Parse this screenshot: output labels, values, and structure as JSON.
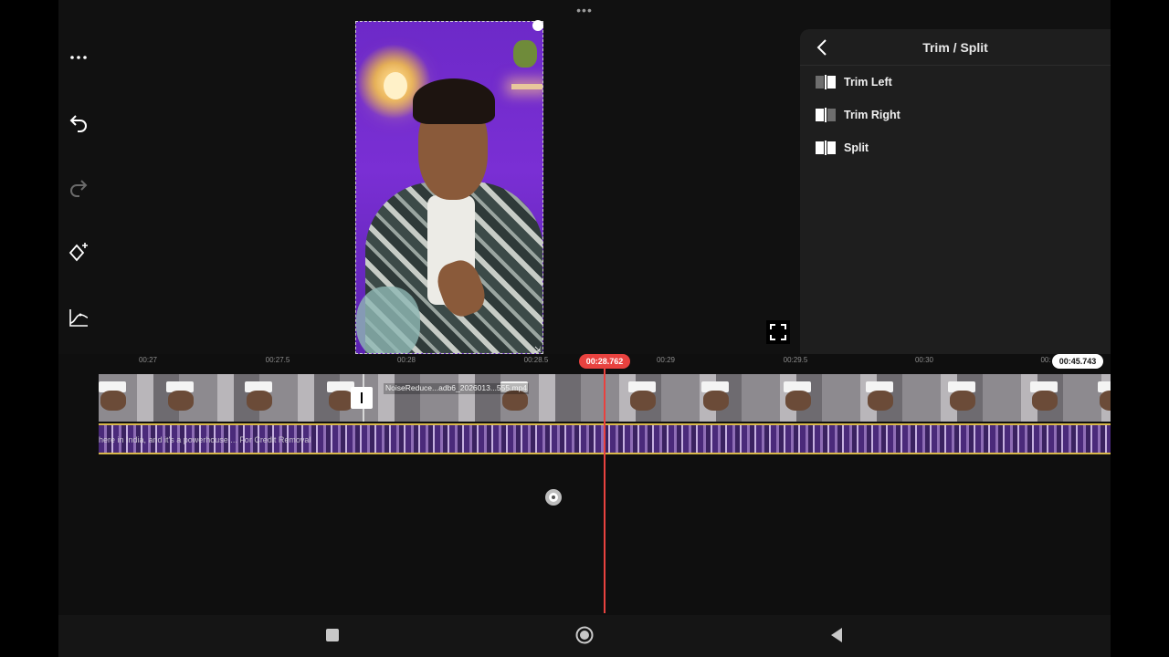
{
  "top_menu_icon": "more-horizontal-icon",
  "left_toolbar": {
    "items": [
      {
        "icon": "more-horizontal-icon"
      },
      {
        "icon": "undo-icon"
      },
      {
        "icon": "redo-icon"
      },
      {
        "icon": "keyframe-diamond-icon"
      },
      {
        "icon": "speed-curve-icon"
      }
    ]
  },
  "panel": {
    "title": "Trim / Split",
    "back_icon": "chevron-left-icon",
    "items": [
      {
        "label": "Trim Left",
        "icon": "trim-left-icon"
      },
      {
        "label": "Trim Right",
        "icon": "trim-right-icon"
      },
      {
        "label": "Split",
        "icon": "split-icon"
      }
    ]
  },
  "timeline": {
    "ticks": [
      "00:27",
      "00:27.5",
      "00:28",
      "00:28.5",
      "00:29",
      "00:29.5",
      "00:30",
      "00:"
    ],
    "current_time": "00:28.762",
    "total_time": "00:45.743",
    "clip_label": "NoiseReduce...adb6_2026013...555.mp4",
    "audio_label": "here in India, and it's a powerhouse ... For Credit Removal"
  },
  "colors": {
    "accent": "#e8423f",
    "audio_border": "#d8b84a",
    "panel_bg": "#1e1e1e",
    "app_bg": "#111111"
  },
  "navbar": {
    "items": [
      {
        "icon": "square-recents-icon"
      },
      {
        "icon": "circle-home-icon"
      },
      {
        "icon": "triangle-back-icon"
      }
    ]
  }
}
